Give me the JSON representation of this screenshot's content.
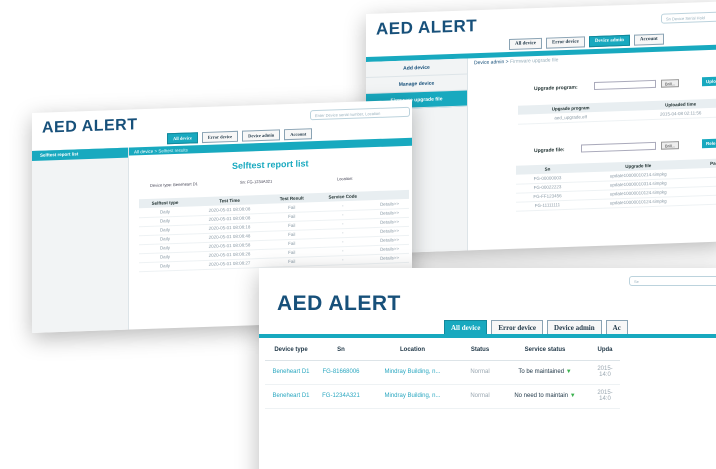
{
  "win_upgrade": {
    "logo": "AED ALERT",
    "search_placeholder": "Sn Device Serial Hold",
    "tabs": [
      "All device",
      "Error device",
      "Device admin",
      "Account"
    ],
    "active_tab": 2,
    "menu": [
      "Add device",
      "Manage device",
      "Firmware upgrade file"
    ],
    "breadcrumb": "Device admin >",
    "breadcrumb_sub": "Firmware upgrade file",
    "upgrade_program_label": "Upgrade program:",
    "browse_label": "Brill...",
    "upload_label": "Uplo",
    "program_table": {
      "columns": [
        "Upgrade program",
        "Uploaded time"
      ],
      "rows": [
        [
          "aed_upgrade.elf",
          "2015-04-08 02:11:56"
        ]
      ]
    },
    "upgrade_file_label": "Upgrade file:",
    "release_label": "Rele",
    "file_table": {
      "columns": [
        "Sn",
        "Upgrade file",
        "Package"
      ],
      "rows": [
        [
          "FG-00000003",
          "update10000010214.simpkg",
          "11"
        ],
        [
          "FG-00022223",
          "update10000010314.simpkg",
          "11"
        ],
        [
          "FG-FF123456",
          "update10000010124.simpkg",
          "11"
        ],
        [
          "FG-11111111",
          "update10000010124.simpkg",
          "9"
        ]
      ]
    }
  },
  "win_selftest": {
    "logo": "AED ALERT",
    "search_placeholder": "Enter Device serial number, Location",
    "tabs": [
      "All device",
      "Error device",
      "Device admin",
      "Account"
    ],
    "active_tab": 0,
    "menu": [
      "Selftest report list"
    ],
    "breadcrumb": "All device >",
    "breadcrumb_sub": "Selftest results",
    "page_title": "Selftest report list",
    "device_type": "Device type: Beneheart D1",
    "sn": "Sn: FG-1234A321",
    "location": "Location:",
    "table": {
      "columns": [
        "Selftest type",
        "Test Time",
        "Test Result",
        "Service Code"
      ],
      "rows": [
        [
          "Daily",
          "2020-05-01 08:08:08",
          "Fail",
          "-",
          "Details>>"
        ],
        [
          "Daily",
          "2020-05-01 08:08:08",
          "Fail",
          "-",
          "Details>>"
        ],
        [
          "Daily",
          "2020-05-01 08:08:18",
          "Fail",
          "-",
          "Details>>"
        ],
        [
          "Daily",
          "2020-05-01 08:08:48",
          "Fail",
          "-",
          "Details>>"
        ],
        [
          "Daily",
          "2020-05-01 08:08:58",
          "Fail",
          "-",
          "Details>>"
        ],
        [
          "Daily",
          "2020-05-01 08:08:28",
          "Fail",
          "-",
          "Details>>"
        ],
        [
          "Daily",
          "2020-05-01 08:08:27",
          "Fail",
          "-",
          "Details>>"
        ]
      ]
    }
  },
  "win_devices": {
    "logo": "AED ALERT",
    "search_placeholder": "Se",
    "tabs": [
      "All device",
      "Error device",
      "Device admin",
      "Ac"
    ],
    "active_tab": 0,
    "columns": [
      "Device type",
      "Sn",
      "Location",
      "Status",
      "Service status",
      "Upda"
    ],
    "rows": [
      {
        "type": "Beneheart D1",
        "sn": "FG-81668006",
        "location": "Mindray Building, n...",
        "status": "Normal",
        "service": "To be maintained",
        "updated_1": "2015-",
        "updated_2": "14:0"
      },
      {
        "type": "Beneheart D1",
        "sn": "FG-1234A321",
        "location": "Mindray Building, n...",
        "status": "Normal",
        "service": "No need to maintain",
        "updated_1": "2015-",
        "updated_2": "14:0"
      }
    ]
  },
  "colors": {
    "brand": "#17507a",
    "accent": "#18a9bf",
    "ok_arrow": "#3bb24e"
  }
}
